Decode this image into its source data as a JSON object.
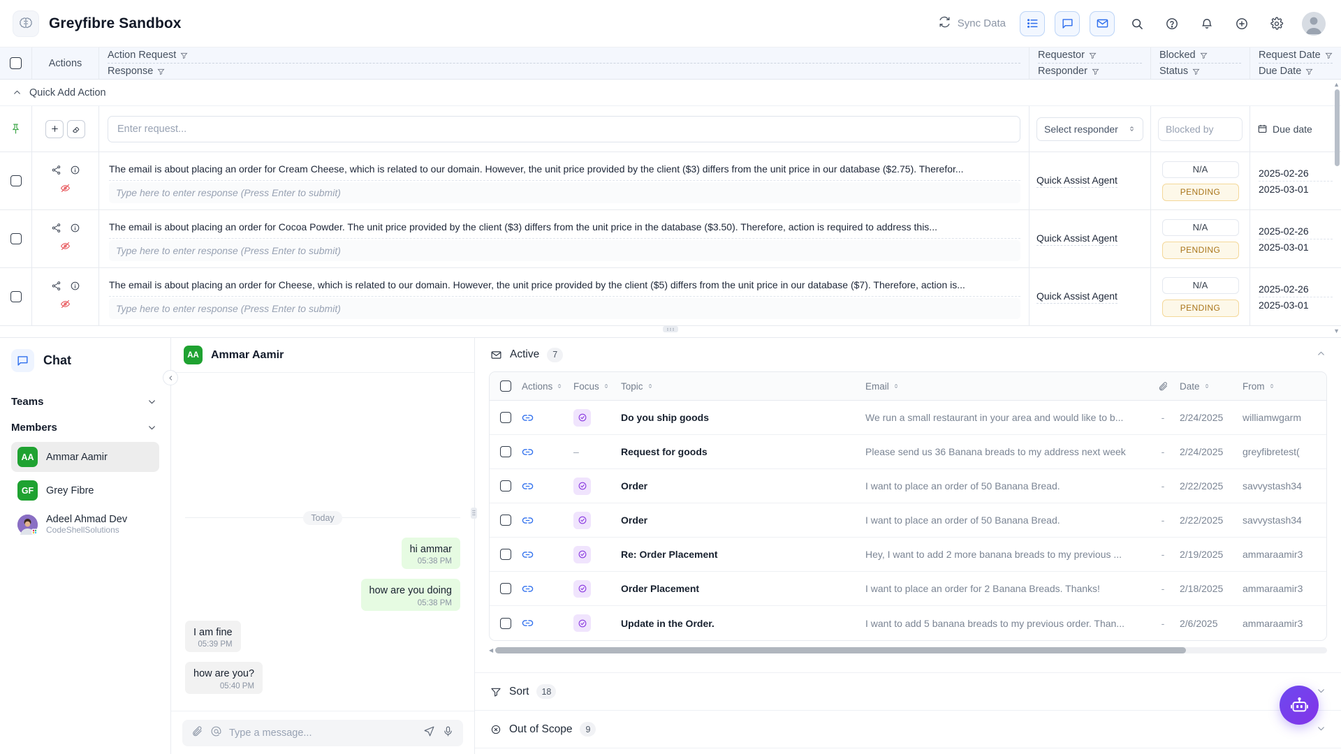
{
  "app": {
    "title": "Greyfibre Sandbox",
    "logo_icon": "brain-logo-icon"
  },
  "topbar": {
    "sync_label": "Sync Data",
    "sync_icon": "refresh-icon",
    "actions": [
      {
        "name": "list-view-button",
        "icon": "list-icon",
        "active": true
      },
      {
        "name": "chat-view-button",
        "icon": "chat-bubble-icon",
        "active": true
      },
      {
        "name": "mail-view-button",
        "icon": "envelope-icon",
        "active": true
      },
      {
        "name": "search-button",
        "icon": "search-icon",
        "active": false
      },
      {
        "name": "help-button",
        "icon": "question-circle-icon",
        "active": false
      },
      {
        "name": "notifications-button",
        "icon": "bell-icon",
        "active": false
      },
      {
        "name": "add-button",
        "icon": "plus-circle-icon",
        "active": false
      },
      {
        "name": "settings-button",
        "icon": "gear-icon",
        "active": false
      }
    ],
    "avatar_label": "user-avatar"
  },
  "action_table": {
    "headers": {
      "actions": "Actions",
      "action_request": "Action Request",
      "response": "Response",
      "requestor": "Requestor",
      "responder": "Responder",
      "blocked": "Blocked",
      "status": "Status",
      "request_date": "Request Date",
      "due_date": "Due Date"
    },
    "quick_add": {
      "label": "Quick Add Action",
      "request_placeholder": "Enter request...",
      "responder_placeholder": "Select responder",
      "blocked_placeholder": "Blocked by",
      "due_placeholder": "Due date"
    },
    "rows": [
      {
        "summary": "The email is about placing an order for Cream Cheese, which is related to our domain. However, the unit price provided by the client ($3) differs from the unit price in our database ($2.75). Therefor...",
        "response_placeholder": "Type here to enter response (Press Enter to submit)",
        "requestor": "Quick Assist Agent",
        "blocked": "N/A",
        "status": "PENDING",
        "request_date": "2025-02-26",
        "due_date": "2025-03-01"
      },
      {
        "summary": "The email is about placing an order for Cocoa Powder. The unit price provided by the client ($3) differs from the unit price in the database ($3.50). Therefore, action is required to address this...",
        "response_placeholder": "Type here to enter response (Press Enter to submit)",
        "requestor": "Quick Assist Agent",
        "blocked": "N/A",
        "status": "PENDING",
        "request_date": "2025-02-26",
        "due_date": "2025-03-01"
      },
      {
        "summary": "The email is about placing an order for Cheese, which is related to our domain. However, the unit price provided by the client ($5) differs from the unit price in our database ($7). Therefore, action is...",
        "response_placeholder": "Type here to enter response (Press Enter to submit)",
        "requestor": "Quick Assist Agent",
        "blocked": "N/A",
        "status": "PENDING",
        "request_date": "2025-02-26",
        "due_date": "2025-03-01"
      }
    ]
  },
  "chat_sidebar": {
    "title": "Chat",
    "teams_label": "Teams",
    "members_label": "Members",
    "members": [
      {
        "initials": "AA",
        "name": "Ammar Aamir",
        "sub": "",
        "active": true
      },
      {
        "initials": "GF",
        "name": "Grey Fibre",
        "sub": "",
        "active": false
      },
      {
        "initials": "",
        "name": "Adeel Ahmad Dev",
        "sub": "CodeShellSolutions",
        "active": false
      }
    ]
  },
  "conversation": {
    "initials": "AA",
    "name": "Ammar Aamir",
    "day_separator": "Today",
    "messages": [
      {
        "text": "hi ammar",
        "time": "05:38 PM",
        "direction": "out"
      },
      {
        "text": "how are you doing",
        "time": "05:38 PM",
        "direction": "out"
      },
      {
        "text": "I am fine",
        "time": "05:39 PM",
        "direction": "in"
      },
      {
        "text": "how are you?",
        "time": "05:40 PM",
        "direction": "in"
      }
    ],
    "composer_placeholder": "Type a message...",
    "attach_icon": "paperclip-icon",
    "mention_icon": "at-icon",
    "send_icon": "send-icon",
    "mic_icon": "microphone-icon"
  },
  "email_panel": {
    "active_section": {
      "label": "Active",
      "count": "7",
      "icon": "envelope-icon"
    },
    "columns": {
      "actions": "Actions",
      "focus": "Focus",
      "topic": "Topic",
      "email": "Email",
      "attachment": "attachment-icon",
      "date": "Date",
      "from": "From"
    },
    "rows": [
      {
        "focus": true,
        "topic": "Do you ship goods",
        "email": "We run a small restaurant in your area and would like to b...",
        "attachment": "-",
        "date": "2/24/2025",
        "from": "williamwgarm"
      },
      {
        "focus": false,
        "topic": "Request for goods",
        "email": "Please send us 36 Banana breads to my address next week",
        "attachment": "-",
        "date": "2/24/2025",
        "from": "greyfibretest("
      },
      {
        "focus": true,
        "topic": "Order",
        "email": "I want to place an order of 50 Banana Bread.",
        "attachment": "-",
        "date": "2/22/2025",
        "from": "savvystash34"
      },
      {
        "focus": true,
        "topic": "Order",
        "email": "I want to place an order of 50 Banana Bread.",
        "attachment": "-",
        "date": "2/22/2025",
        "from": "savvystash34"
      },
      {
        "focus": true,
        "topic": "Re: Order Placement",
        "email": "Hey, I want to add 2 more banana breads to my previous ...",
        "attachment": "-",
        "date": "2/19/2025",
        "from": "ammaraamir3"
      },
      {
        "focus": true,
        "topic": "Order Placement",
        "email": "I want to place an order for 2 Banana Breads. Thanks!",
        "attachment": "-",
        "date": "2/18/2025",
        "from": "ammaraamir3"
      },
      {
        "focus": true,
        "topic": "Update in the Order.",
        "email": "I want to add 5 banana breads to my previous order. Than...",
        "attachment": "-",
        "date": "2/6/2025",
        "from": "ammaraamir3"
      }
    ],
    "sort_section": {
      "label": "Sort",
      "count": "18",
      "icon": "filter-icon"
    },
    "out_of_scope_section": {
      "label": "Out of Scope",
      "count": "9",
      "icon": "x-circle-icon"
    }
  },
  "fab": {
    "icon": "robot-icon"
  },
  "colors": {
    "accent": "#2f6fed",
    "status_pending_bg": "#fdf8e9",
    "status_pending_text": "#a9751a",
    "avatar_green": "#1fa231",
    "fab_purple": "#6d49ef",
    "bubble_out": "#e6fbe2",
    "bubble_in": "#f2f2f2"
  }
}
